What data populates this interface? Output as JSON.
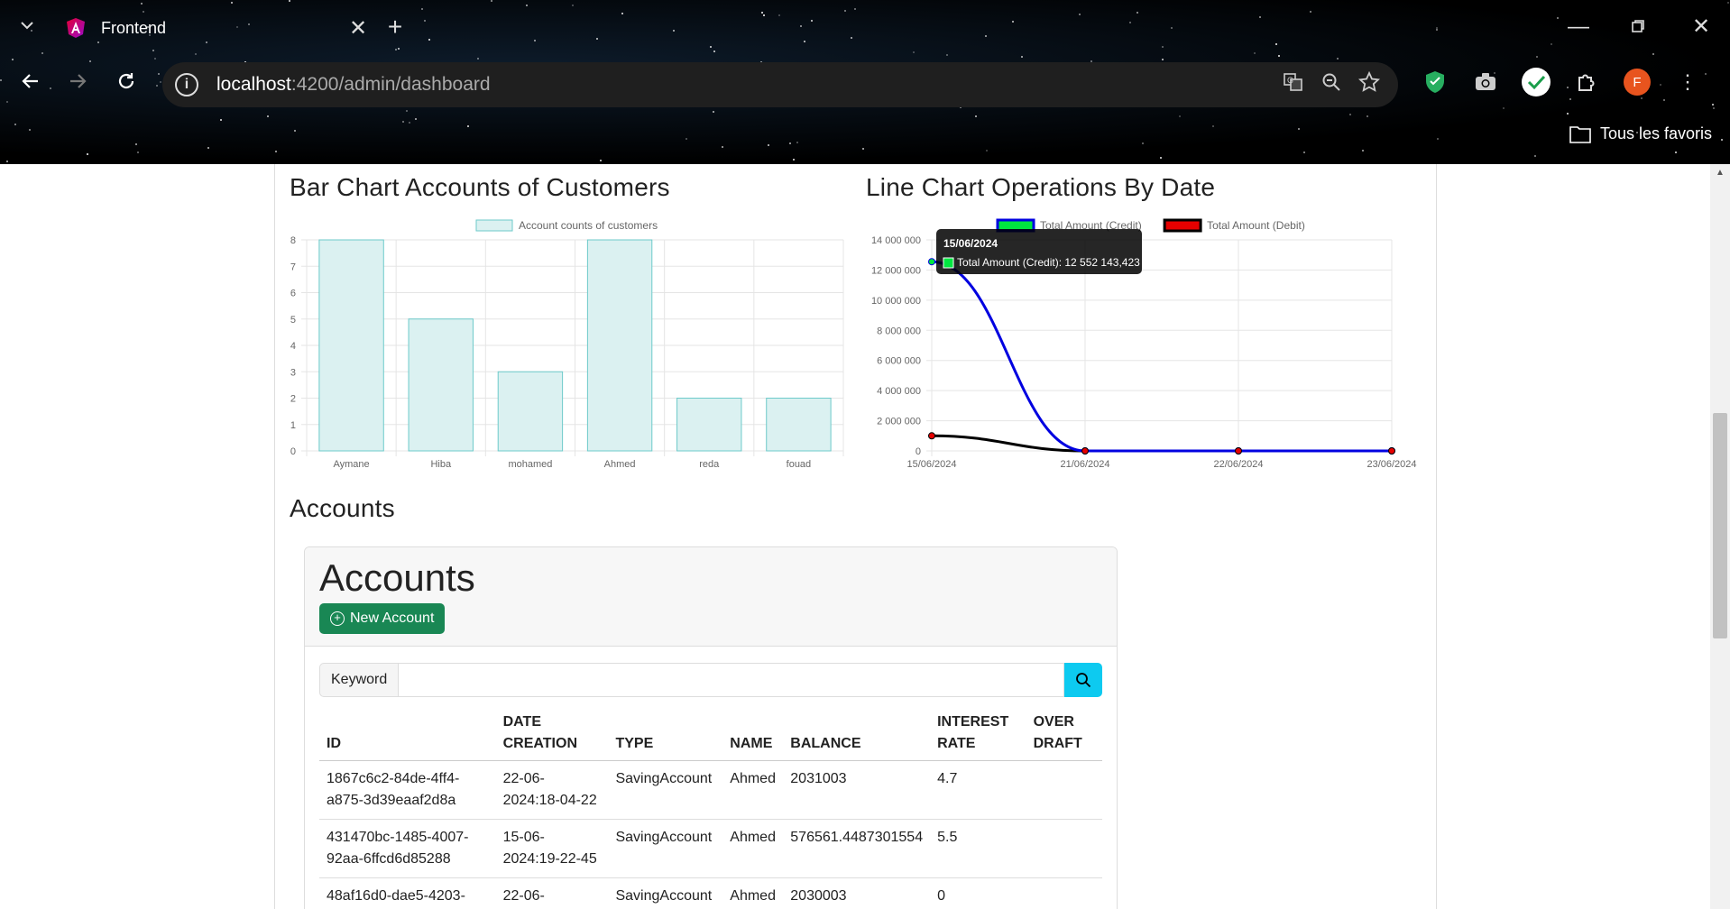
{
  "browser": {
    "tab_title": "Frontend",
    "url_host": "localhost",
    "url_path": ":4200/admin/dashboard",
    "bookmarks_label": "Tous les favoris",
    "profile_initial": "F"
  },
  "bar_section": {
    "title": "Bar Chart Accounts of Customers"
  },
  "line_section": {
    "title": "Line Chart Operations By Date"
  },
  "accounts_section": {
    "title": "Accounts"
  },
  "card": {
    "title": "Accounts",
    "new_button": "New Account",
    "search_label": "Keyword",
    "search_value": ""
  },
  "table": {
    "headers": [
      "ID",
      "DATE CREATION",
      "TYPE",
      "NAME",
      "BALANCE",
      "INTEREST RATE",
      "OVER DRAFT"
    ],
    "rows": [
      [
        "1867c6c2-84de-4ff4-a875-3d39eaaf2d8a",
        "22-06-2024:18-04-22",
        "SavingAccount",
        "Ahmed",
        "2031003",
        "4.7",
        ""
      ],
      [
        "431470bc-1485-4007-92aa-6ffcd6d85288",
        "15-06-2024:19-22-45",
        "SavingAccount",
        "Ahmed",
        "576561.4487301554",
        "5.5",
        ""
      ],
      [
        "48af16d0-dae5-4203-",
        "22-06-",
        "SavingAccount",
        "Ahmed",
        "2030003",
        "0",
        ""
      ]
    ]
  },
  "chart_data": [
    {
      "type": "bar",
      "legend": [
        "Account counts of customers"
      ],
      "categories": [
        "Aymane",
        "Hiba",
        "mohamed",
        "Ahmed",
        "reda",
        "fouad"
      ],
      "series": [
        {
          "name": "Account counts of customers",
          "values": [
            8,
            5,
            3,
            8,
            2,
            2
          ]
        }
      ],
      "yticks": [
        "0",
        "1",
        "2",
        "3",
        "4",
        "5",
        "6",
        "7",
        "8"
      ],
      "ylim": [
        0,
        8
      ],
      "colors": {
        "fill": "#dbf1f1",
        "stroke": "#6dcaca"
      },
      "legend_position": "top"
    },
    {
      "type": "line",
      "categories": [
        "15/06/2024",
        "21/06/2024",
        "22/06/2024",
        "23/06/2024"
      ],
      "series": [
        {
          "name": "Total Amount (Credit)",
          "values": [
            12552143.423,
            0,
            0,
            0
          ],
          "color": "#0000e0",
          "legend_fill": "#00e640"
        },
        {
          "name": "Total Amount (Debit)",
          "values": [
            1000000,
            0,
            0,
            0
          ],
          "color": "#000000",
          "legend_fill": "#e60000"
        }
      ],
      "yticks": [
        "0",
        "2 000 000",
        "4 000 000",
        "6 000 000",
        "8 000 000",
        "10 000 000",
        "12 000 000",
        "14 000 000"
      ],
      "ylim": [
        0,
        14000000
      ],
      "tooltip": {
        "title": "15/06/2024",
        "label": "Total Amount (Credit): 12 552 143,423"
      },
      "legend_position": "top"
    }
  ]
}
